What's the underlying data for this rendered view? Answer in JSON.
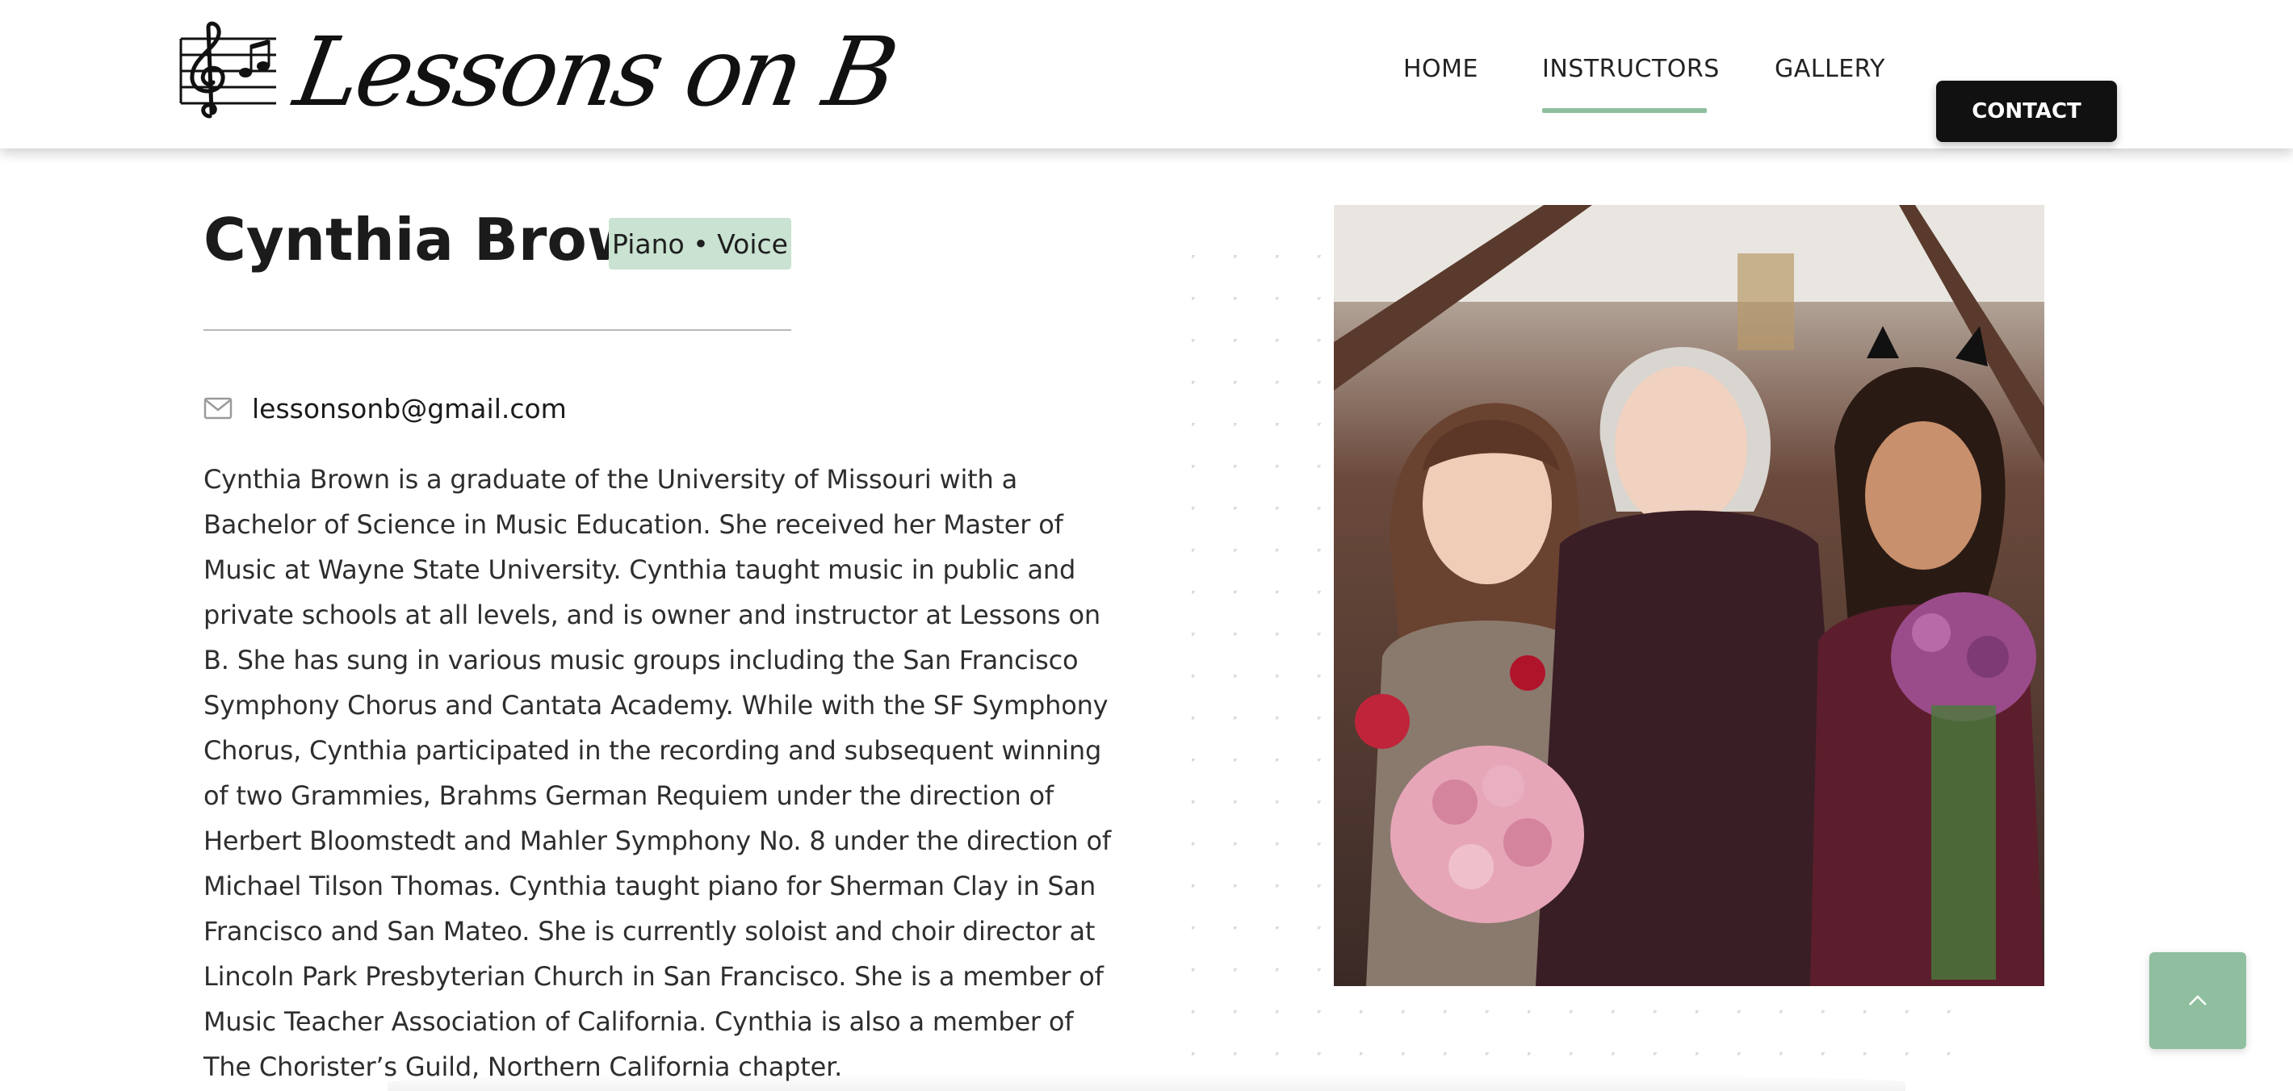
{
  "header": {
    "logo_text": "Lessons on B",
    "nav": {
      "home": "HOME",
      "instructors": "INSTRUCTORS",
      "gallery": "GALLERY",
      "contact": "CONTACT"
    },
    "active_item": "INSTRUCTORS"
  },
  "instructor": {
    "name": "Cynthia Brown",
    "badge": "Piano • Voice",
    "email": "lessonsonb@gmail.com",
    "bio": "Cynthia Brown is a graduate of the University of Missouri with a Bachelor of Science in Music Education. She received her Master of Music at Wayne State University. Cynthia taught music in public and private schools at all levels, and is owner and instructor at Lessons on B. She has sung in various music groups including the San Francisco Symphony Chorus and Cantata Academy. While with the SF Symphony Chorus, Cynthia participated in the recording and subsequent winning of two Grammies, Brahms German Requiem under the direction of Herbert Bloomstedt and Mahler Symphony No. 8 under the direction of Michael Tilson Thomas. Cynthia taught piano for Sherman Clay in San Francisco and San Mateo. She is currently soloist and choir director at Lincoln Park Presbyterian Church in San Francisco. She is a member of Music Teacher Association of California. Cynthia is also a member of The Chorister’s Guild, Northern California chapter."
  },
  "icons": {
    "mail": "mail-icon",
    "back_to_top": "chevron-up-icon",
    "logo": "treble-clef-staff-icon"
  },
  "colors": {
    "accent": "#8fbf9e",
    "badge_bg": "#c9e2d1",
    "contact_bg": "#111111",
    "text": "#1b1b1b"
  }
}
